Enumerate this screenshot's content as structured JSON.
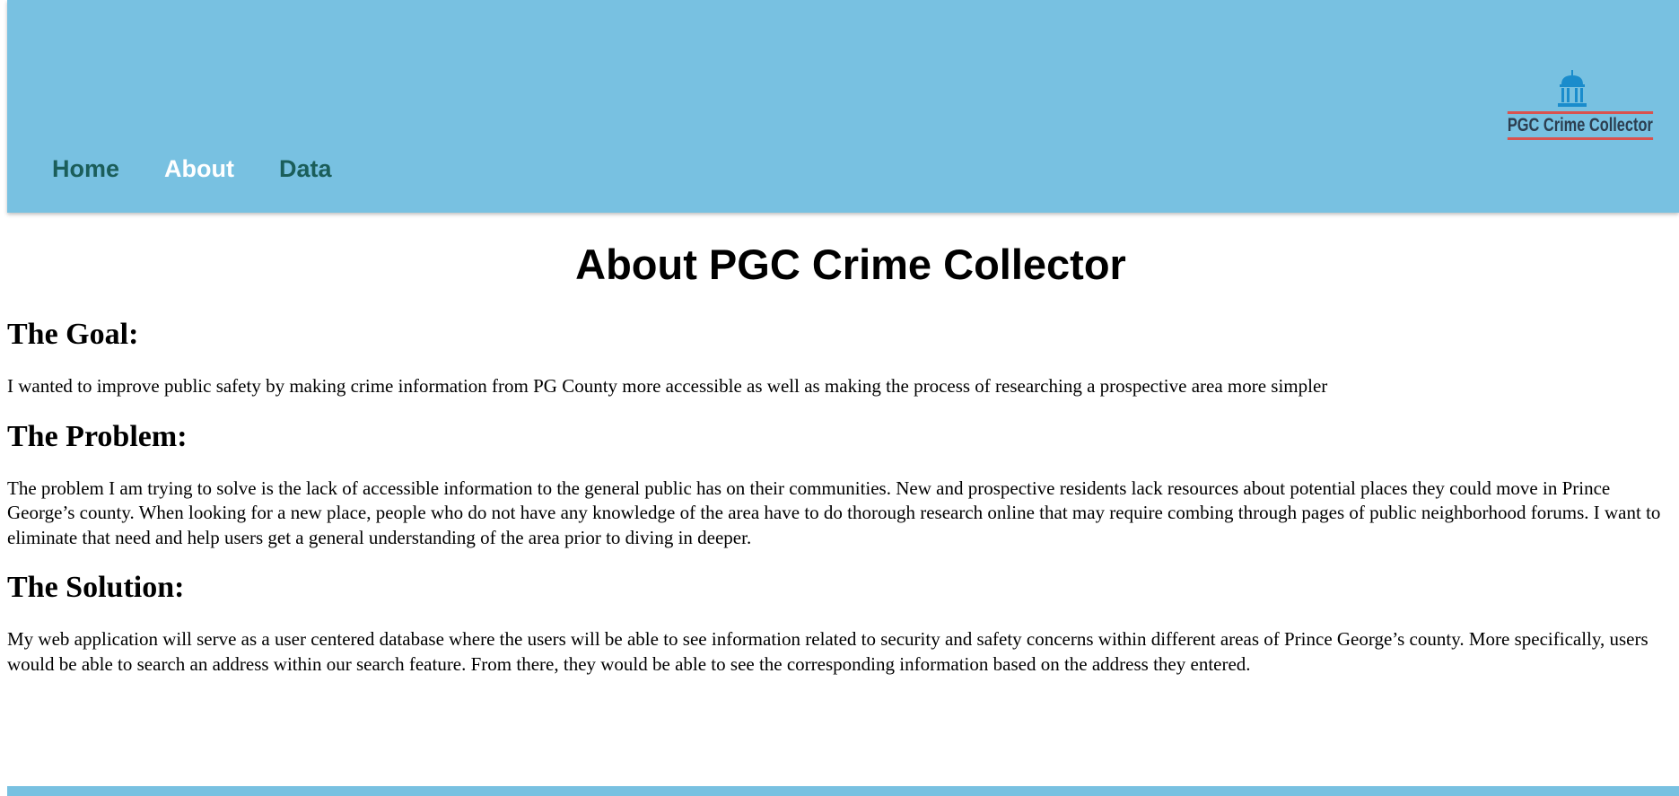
{
  "nav": {
    "items": [
      {
        "label": "Home"
      },
      {
        "label": "About"
      },
      {
        "label": "Data"
      }
    ],
    "active": "About"
  },
  "logo": {
    "text": "PGC Crime Collector",
    "icon": "capitol-building-icon"
  },
  "page": {
    "title": "About PGC Crime Collector"
  },
  "sections": [
    {
      "heading": "The Goal:",
      "body": "I wanted to improve public safety by making crime information from PG County more accessible as well as making the process of researching a prospective area more simpler"
    },
    {
      "heading": "The Problem:",
      "body": "The problem I am trying to solve is the lack of accessible information to the general public has on their communities. New and prospective residents lack resources about potential places they could move in Prince George’s county. When looking for a new place, people who do not have any knowledge of the area have to do thorough research online that may require combing through pages of public neighborhood forums. I want to eliminate that need and help users get a general understanding of the area prior to diving in deeper."
    },
    {
      "heading": "The Solution:",
      "body": "My web application will serve as a user centered database where the users will be able to see information related to security and safety concerns within different areas of Prince George’s county. More specifically, users would be able to search an address within our search feature. From there, they would be able to see the corresponding information based on the address they entered."
    }
  ],
  "colors": {
    "header_bg": "#78c1e1",
    "nav_link": "#1b5e5a",
    "nav_active": "#ffffff",
    "logo_icon": "#1a8ccc",
    "logo_stripe": "#d9534f"
  }
}
